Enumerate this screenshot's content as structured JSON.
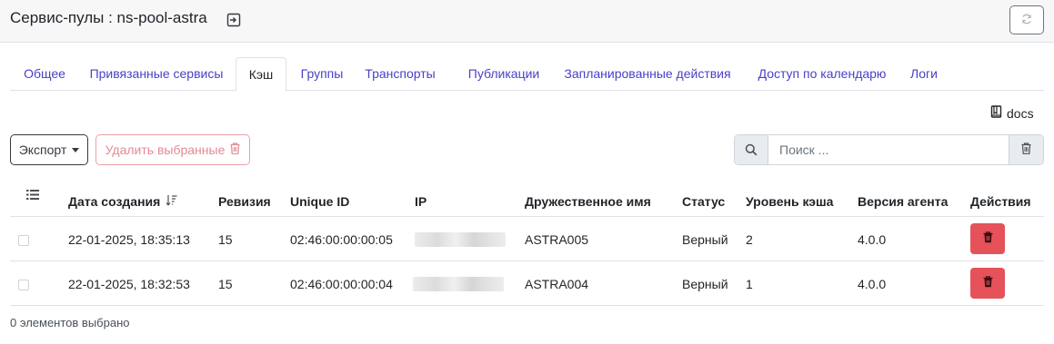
{
  "header": {
    "title": "Сервис-пулы : ns-pool-astra"
  },
  "tabs": [
    {
      "label": "Общее",
      "active": false
    },
    {
      "label": "Привязанные сервисы",
      "active": false
    },
    {
      "label": "Кэш",
      "active": true
    },
    {
      "label": "Группы",
      "active": false
    },
    {
      "label": "Транспорты",
      "active": false
    },
    {
      "label": "Публикации",
      "active": false
    },
    {
      "label": "Запланированные действия",
      "active": false
    },
    {
      "label": "Доступ по календарю",
      "active": false
    },
    {
      "label": "Логи",
      "active": false
    }
  ],
  "toolbar": {
    "docs_label": "docs",
    "export_label": "Экспорт",
    "delete_selected_label": "Удалить выбранные",
    "search_placeholder": "Поиск ..."
  },
  "table": {
    "columns": {
      "created": "Дата создания",
      "revision": "Ревизия",
      "unique_id": "Unique ID",
      "ip": "IP",
      "friendly_name": "Дружественное имя",
      "status": "Статус",
      "cache_level": "Уровень кэша",
      "agent_version": "Версия агента",
      "actions": "Действия"
    },
    "rows": [
      {
        "created": "22-01-2025, 18:35:13",
        "revision": "15",
        "unique_id": "02:46:00:00:00:05",
        "friendly_name": "ASTRA005",
        "status": "Верный",
        "cache_level": "2",
        "agent_version": "4.0.0"
      },
      {
        "created": "22-01-2025, 18:32:53",
        "revision": "15",
        "unique_id": "02:46:00:00:00:04",
        "friendly_name": "ASTRA004",
        "status": "Верный",
        "cache_level": "1",
        "agent_version": "4.0.0"
      }
    ]
  },
  "footer": {
    "selected_count": "0 элементов выбрано"
  },
  "colors": {
    "link": "#4a40c8",
    "danger": "#e5525a",
    "danger_light": "#e38a92"
  },
  "icons": [
    "exit-icon",
    "refresh-icon",
    "book-icon",
    "search-icon",
    "trash-icon",
    "columns-menu-icon",
    "sort-desc-icon"
  ]
}
